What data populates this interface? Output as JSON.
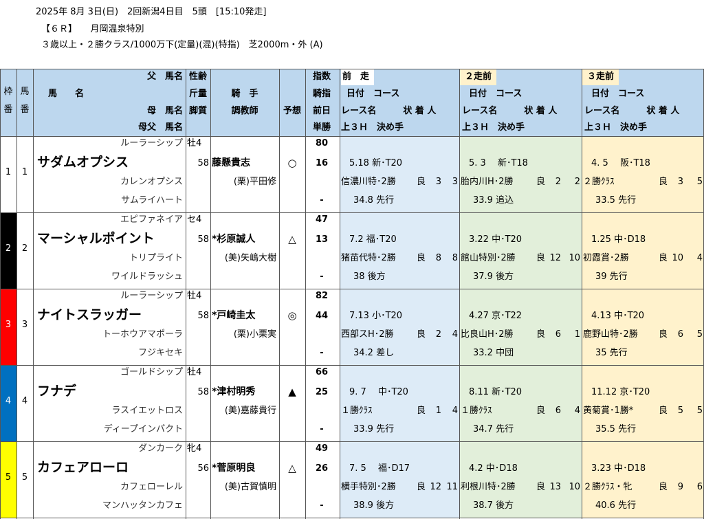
{
  "header": {
    "line1": "2025年 8月 3日(日)　2回新潟4日目　5頭　[15:10発走]",
    "line2": "【６Ｒ】　　月岡温泉特別",
    "line3": "３歳以上・２勝クラス/1000万下(定量)(混)(特指)　芝2000m・外 (A)"
  },
  "columns": {
    "waku": "枠番",
    "umaban": "馬番",
    "father": "父　馬名",
    "horse": "馬　　名",
    "mother": "母　馬名",
    "motherfather": "母父　馬名",
    "sex": "性齢",
    "weight": "斤量",
    "legs": "脚質",
    "jockey": "騎　手",
    "trainer": "調教師",
    "pred": "予想",
    "index1": "指数",
    "index2": "騎指",
    "index3": "前日",
    "index4": "単勝",
    "prev1": "前　走",
    "prev2": "２走前",
    "prev3": "３走前",
    "date_course": "日付　コース",
    "race_row": "レース名　　　状 着 人",
    "last3h": "上３Ｈ　決め手"
  },
  "horses": [
    {
      "waku": "1",
      "umaban": "1",
      "waku_color": "#ffffff",
      "waku_text": "#000000",
      "father": "ルーラーシップ",
      "name": "サダムオプシス",
      "mother": "カレンオプシス",
      "motherfather": "サムライハート",
      "sex": "牡4",
      "weight": "58",
      "jockey": "藤懸貴志",
      "trainer": "(栗)平田修",
      "pred": "○",
      "idx": "80",
      "idx2": "16",
      "idx3": "",
      "idx4": "-",
      "races": [
        {
          "date": "5.18 新･T20",
          "name": "信濃川特･2勝",
          "cond": "良",
          "pos": "3",
          "pop": "3",
          "l3": "34.8 先行"
        },
        {
          "date": "5. 3　 新･T18",
          "name": "胎内川H･2勝",
          "cond": "良",
          "pos": "2",
          "pop": "2",
          "l3": "33.9 追込"
        },
        {
          "date": "4. 5　 阪･T18",
          "name": "２勝ｸﾗｽ",
          "cond": "良",
          "pos": "3",
          "pop": "5",
          "l3": "33.5 先行"
        }
      ]
    },
    {
      "waku": "2",
      "umaban": "2",
      "waku_color": "#000000",
      "waku_text": "#ffffff",
      "father": "エピファネイア",
      "name": "マーシャルポイント",
      "mother": "トリプライト",
      "motherfather": "ワイルドラッシュ",
      "sex": "セ4",
      "weight": "58",
      "jockey": "*杉原誠人",
      "trainer": "(美)矢嶋大樹",
      "pred": "△",
      "idx": "47",
      "idx2": "13",
      "idx3": "",
      "idx4": "-",
      "races": [
        {
          "date": "7.2 福･T20",
          "name": "猪苗代特･2勝",
          "cond": "良",
          "pos": "8",
          "pop": "8",
          "l3": "38 後方"
        },
        {
          "date": "3.22 中･T20",
          "name": "館山特別･2勝",
          "cond": "良",
          "pos": "12",
          "pop": "10",
          "l3": "37.9 後方"
        },
        {
          "date": "1.25 中･D18",
          "name": "初霞賞･2勝",
          "cond": "良",
          "pos": "10",
          "pop": "4",
          "l3": "39 先行"
        }
      ]
    },
    {
      "waku": "3",
      "umaban": "3",
      "waku_color": "#ff0000",
      "waku_text": "#ffffff",
      "father": "ルーラーシップ",
      "name": "ナイトスラッガー",
      "mother": "トーホウアマポーラ",
      "motherfather": "フジキセキ",
      "sex": "牡4",
      "weight": "58",
      "jockey": "*戸崎圭太",
      "trainer": "(栗)小栗実",
      "pred": "◎",
      "idx": "82",
      "idx2": "44",
      "idx3": "",
      "idx4": "-",
      "races": [
        {
          "date": "7.13 小･T20",
          "name": "西部スH･2勝",
          "cond": "良",
          "pos": "2",
          "pop": "4",
          "l3": "34.2 差し"
        },
        {
          "date": "4.27 京･T22",
          "name": "比良山H･2勝",
          "cond": "良",
          "pos": "6",
          "pop": "1",
          "l3": "33.2 中団"
        },
        {
          "date": "4.13 中･T20",
          "name": "鹿野山特･2勝",
          "cond": "良",
          "pos": "6",
          "pop": "5",
          "l3": "35 先行"
        }
      ]
    },
    {
      "waku": "4",
      "umaban": "4",
      "waku_color": "#0070c0",
      "waku_text": "#ffffff",
      "father": "ゴールドシップ",
      "name": "フナデ",
      "mother": "ラスイエットロス",
      "motherfather": "ディープインパクト",
      "sex": "牡4",
      "weight": "58",
      "jockey": "*津村明秀",
      "trainer": "(美)嘉藤貴行",
      "pred": "▲",
      "idx": "66",
      "idx2": "25",
      "idx3": "",
      "idx4": "-",
      "races": [
        {
          "date": "9. 7　 中･T20",
          "name": "１勝ｸﾗｽ",
          "cond": "良",
          "pos": "1",
          "pop": "4",
          "l3": "33.9 先行"
        },
        {
          "date": "8.11 新･T20",
          "name": "１勝ｸﾗｽ",
          "cond": "良",
          "pos": "6",
          "pop": "4",
          "l3": "34.7 先行"
        },
        {
          "date": "11.12 京･T20",
          "name": "黄菊賞･1勝*",
          "cond": "良",
          "pos": "5",
          "pop": "5",
          "l3": "35.5 先行"
        }
      ]
    },
    {
      "waku": "5",
      "umaban": "5",
      "waku_color": "#ffff00",
      "waku_text": "#000000",
      "father": "ダンカーク",
      "name": "カフェアローロ",
      "mother": "カフェローレル",
      "motherfather": "マンハッタンカフェ",
      "sex": "牝4",
      "weight": "56",
      "jockey": "*菅原明良",
      "trainer": "(美)古賀慎明",
      "pred": "△",
      "idx": "49",
      "idx2": "26",
      "idx3": "",
      "idx4": "-",
      "races": [
        {
          "date": "7. 5　 福･D17",
          "name": "横手特別･2勝",
          "cond": "良",
          "pos": "12",
          "pop": "11",
          "l3": "38.9 後方"
        },
        {
          "date": "4.2 中･D18",
          "name": "利根川特･2勝",
          "cond": "良",
          "pos": "13",
          "pop": "10",
          "l3": "38.7 後方"
        },
        {
          "date": "3.23 中･D18",
          "name": "２勝ｸﾗｽ・牝",
          "cond": "良",
          "pos": "9",
          "pop": "6",
          "l3": "40.6 先行"
        }
      ]
    }
  ]
}
